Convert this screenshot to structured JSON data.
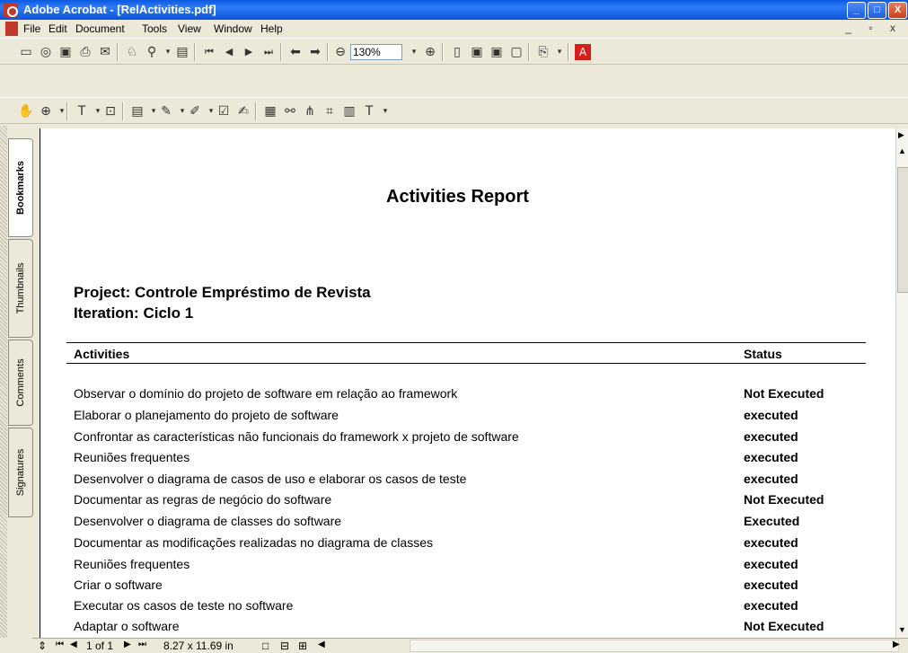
{
  "window": {
    "title": "Adobe Acrobat - [RelActivities.pdf]",
    "minimize": "_",
    "maximize": "□",
    "close": "X"
  },
  "menu": {
    "items": [
      "File",
      "Edit",
      "Document",
      "Tools",
      "View",
      "Window",
      "Help"
    ],
    "mdi_controls": "_ ▫ x"
  },
  "toolbar": {
    "zoom_value": "130%"
  },
  "side_tabs": [
    "Bookmarks",
    "Thumbnails",
    "Comments",
    "Signatures"
  ],
  "document": {
    "title": "Activities Report",
    "project": "Project: Controle Empréstimo de Revista",
    "iteration": "Iteration: Ciclo 1",
    "columns": {
      "activities": "Activities",
      "status": "Status"
    },
    "rows": [
      {
        "activity": "Observar o domínio do projeto de software em relação ao framework",
        "status": "Not Executed"
      },
      {
        "activity": "Elaborar o planejamento do projeto de software",
        "status": "executed"
      },
      {
        "activity": "Confrontar as características não funcionais do framework x projeto de software",
        "status": "executed"
      },
      {
        "activity": "Reuniões frequentes",
        "status": "executed"
      },
      {
        "activity": "Desenvolver o diagrama de casos de uso e elaborar os casos de teste",
        "status": "executed"
      },
      {
        "activity": "Documentar as regras de negócio do software",
        "status": "Not Executed"
      },
      {
        "activity": "Desenvolver o diagrama de classes do software",
        "status": "Executed"
      },
      {
        "activity": "Documentar as modificações realizadas no diagrama de classes",
        "status": "executed"
      },
      {
        "activity": "Reuniões frequentes",
        "status": "executed"
      },
      {
        "activity": "Criar o software",
        "status": "executed"
      },
      {
        "activity": "Executar os casos de teste no software",
        "status": "executed"
      },
      {
        "activity": "Adaptar o software",
        "status": "Not Executed"
      }
    ]
  },
  "statusbar": {
    "page_indicator": "1 of 1",
    "page_size": "8.27 x 11.69 in"
  }
}
